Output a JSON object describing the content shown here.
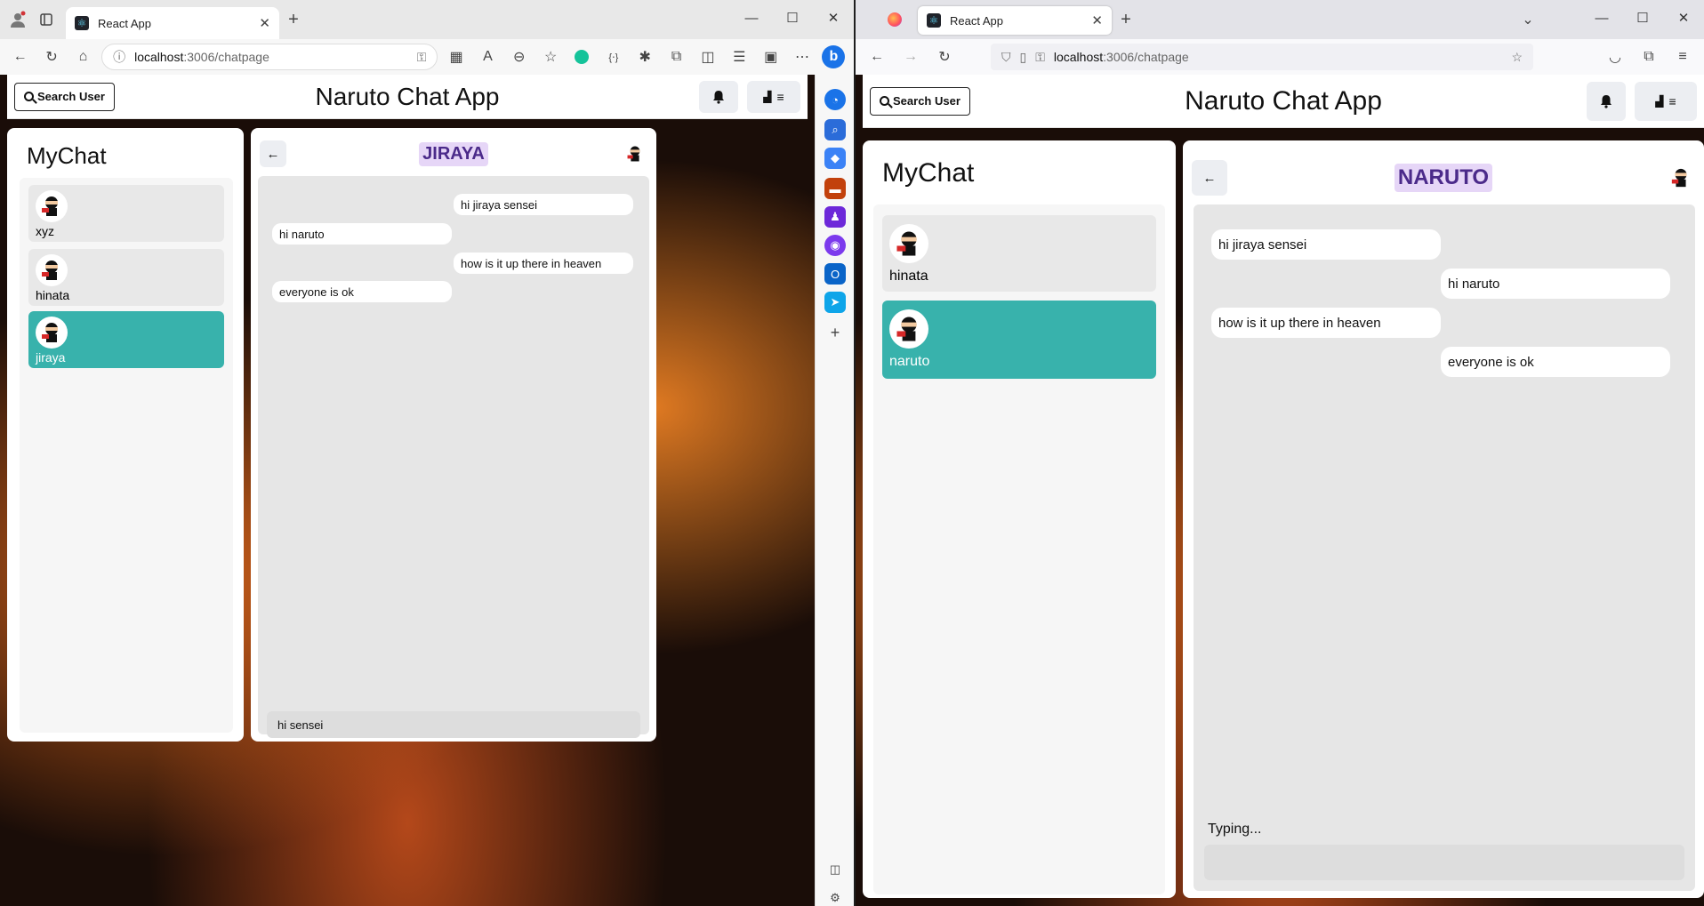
{
  "left": {
    "tab_title": "React App",
    "url_host": "localhost",
    "url_path": ":3006/chatpage",
    "header": {
      "search_label": "Search User",
      "title": "Naruto Chat App"
    },
    "sidebar": {
      "title": "MyChat",
      "users": [
        {
          "name": "xyz"
        },
        {
          "name": "hinata"
        },
        {
          "name": "jiraya"
        }
      ]
    },
    "chat": {
      "name": "JIRAYA",
      "messages": [
        {
          "text": "hi jiraya sensei",
          "side": "right"
        },
        {
          "text": "hi naruto",
          "side": "left"
        },
        {
          "text": "how is it up there in heaven",
          "side": "right"
        },
        {
          "text": "everyone is ok",
          "side": "left"
        }
      ],
      "input_value": "hi sensei"
    }
  },
  "right": {
    "tab_title": "React App",
    "url_host": "localhost",
    "url_path": ":3006/chatpage",
    "header": {
      "search_label": "Search User",
      "title": "Naruto Chat App"
    },
    "sidebar": {
      "title": "MyChat",
      "users": [
        {
          "name": "hinata"
        },
        {
          "name": "naruto"
        }
      ]
    },
    "chat": {
      "name": "NARUTO",
      "messages": [
        {
          "text": "hi jiraya sensei",
          "side": "left"
        },
        {
          "text": "hi naruto",
          "side": "right"
        },
        {
          "text": "how is it up there in heaven",
          "side": "left"
        },
        {
          "text": "everyone is ok",
          "side": "right"
        }
      ],
      "typing": "Typing...",
      "input_value": ""
    }
  },
  "colors": {
    "accent": "#38b2ac",
    "chat_name_bg": "#e6d6f7",
    "chat_name_fg": "#4b2a8a"
  }
}
